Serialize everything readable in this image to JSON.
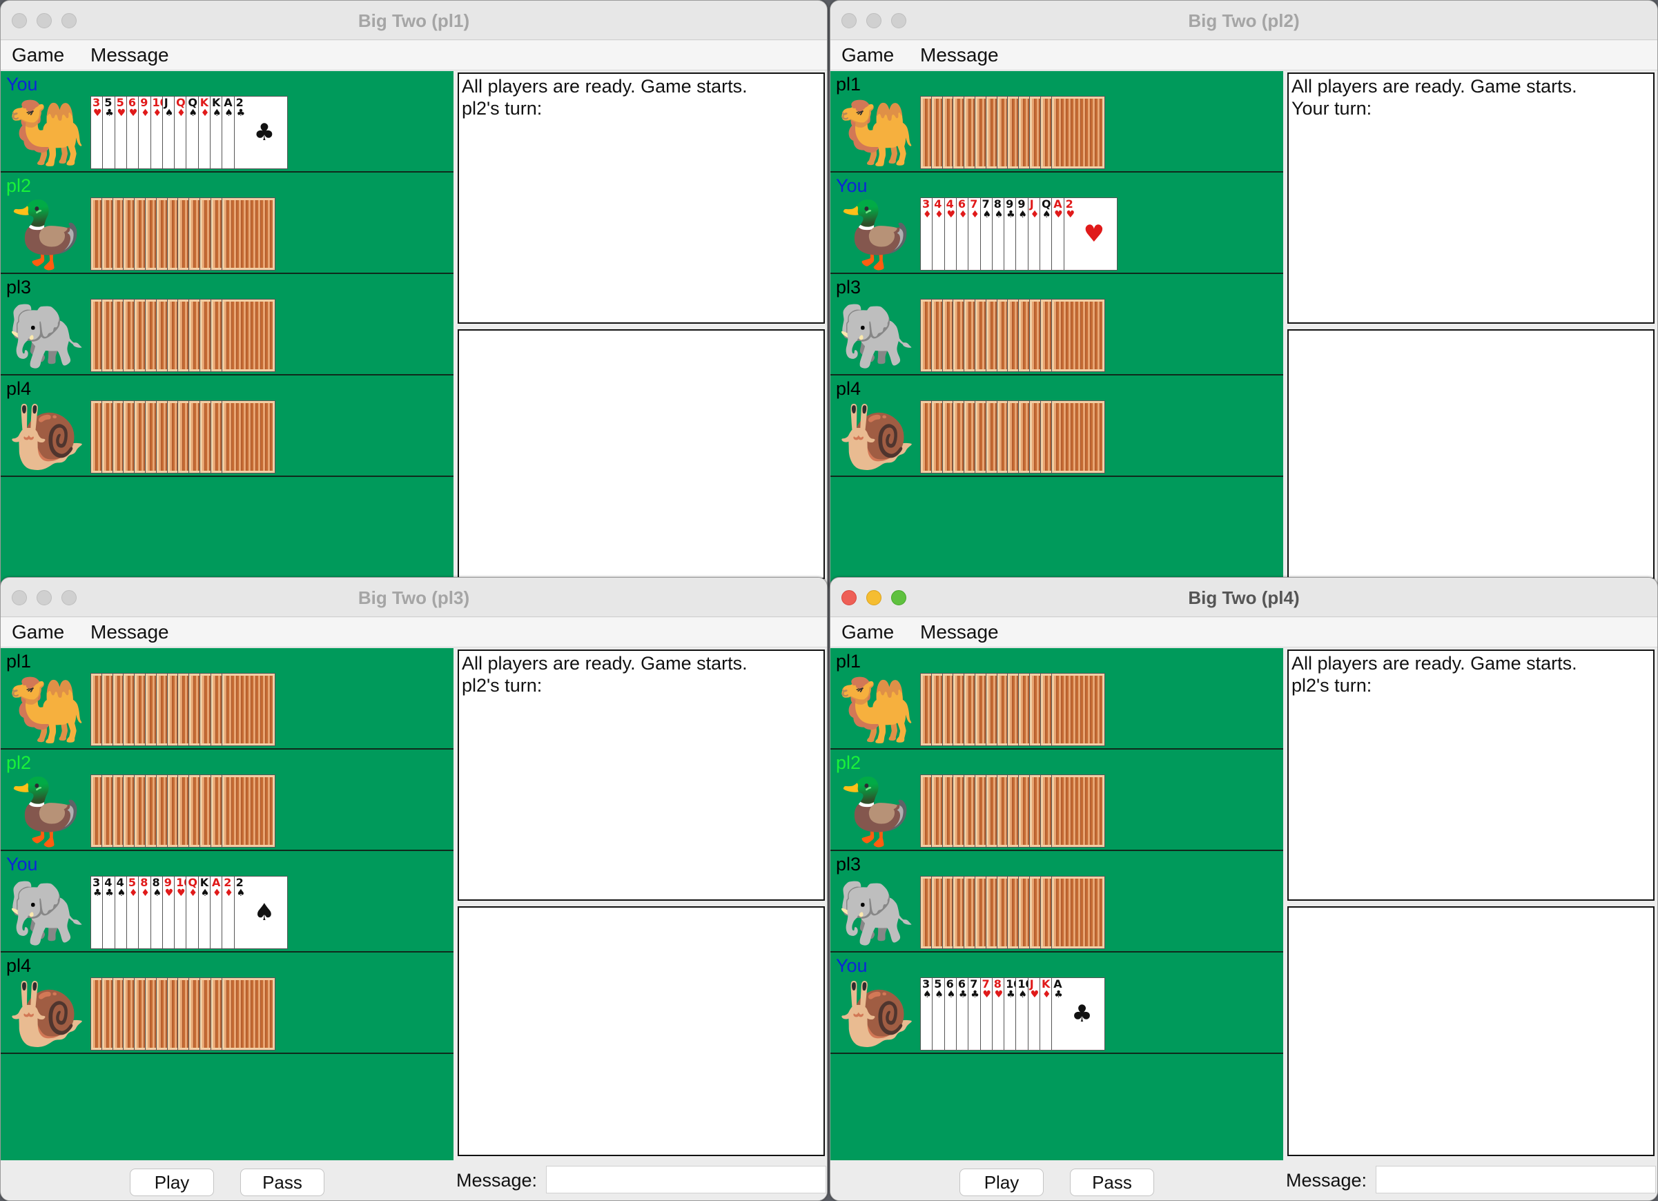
{
  "menu": {
    "game": "Game",
    "message": "Message"
  },
  "controls": {
    "play": "Play",
    "pass": "Pass",
    "message_label": "Message:",
    "message_value": ""
  },
  "windows": [
    {
      "title": "Big Two (pl1)",
      "messages": [
        "All players are ready. Game starts.",
        "pl2's turn:"
      ],
      "players": [
        {
          "name": "You",
          "avatar": "camel",
          "avatar_glyph": "🐫"
        },
        {
          "name": "pl2",
          "avatar": "duck",
          "avatar_glyph": "🦆"
        },
        {
          "name": "pl3",
          "avatar": "elephant",
          "avatar_glyph": "🐘"
        },
        {
          "name": "pl4",
          "avatar": "snail",
          "avatar_glyph": "🐌"
        }
      ],
      "hand": [
        {
          "rank": "3",
          "suit": "♥",
          "color": "red"
        },
        {
          "rank": "5",
          "suit": "♣",
          "color": "blk"
        },
        {
          "rank": "5",
          "suit": "♥",
          "color": "red"
        },
        {
          "rank": "6",
          "suit": "♥",
          "color": "red"
        },
        {
          "rank": "9",
          "suit": "♦",
          "color": "red"
        },
        {
          "rank": "10",
          "suit": "♦",
          "color": "red"
        },
        {
          "rank": "J",
          "suit": "♠",
          "color": "blk"
        },
        {
          "rank": "Q",
          "suit": "♦",
          "color": "red"
        },
        {
          "rank": "Q",
          "suit": "♠",
          "color": "blk"
        },
        {
          "rank": "K",
          "suit": "♦",
          "color": "red"
        },
        {
          "rank": "K",
          "suit": "♠",
          "color": "blk"
        },
        {
          "rank": "A",
          "suit": "♠",
          "color": "blk"
        },
        {
          "rank": "2",
          "suit": "♣",
          "color": "blk"
        }
      ]
    },
    {
      "title": "Big Two (pl2)",
      "messages": [
        "All players are ready. Game starts.",
        "Your turn:"
      ],
      "players": [
        {
          "name": "pl1",
          "avatar": "camel",
          "avatar_glyph": "🐫"
        },
        {
          "name": "You",
          "avatar": "duck",
          "avatar_glyph": "🦆"
        },
        {
          "name": "pl3",
          "avatar": "elephant",
          "avatar_glyph": "🐘"
        },
        {
          "name": "pl4",
          "avatar": "snail",
          "avatar_glyph": "🐌"
        }
      ],
      "hand": [
        {
          "rank": "3",
          "suit": "♦",
          "color": "red"
        },
        {
          "rank": "4",
          "suit": "♦",
          "color": "red"
        },
        {
          "rank": "4",
          "suit": "♥",
          "color": "red"
        },
        {
          "rank": "6",
          "suit": "♦",
          "color": "red"
        },
        {
          "rank": "7",
          "suit": "♦",
          "color": "red"
        },
        {
          "rank": "7",
          "suit": "♠",
          "color": "blk"
        },
        {
          "rank": "8",
          "suit": "♠",
          "color": "blk"
        },
        {
          "rank": "9",
          "suit": "♣",
          "color": "blk"
        },
        {
          "rank": "9",
          "suit": "♠",
          "color": "blk"
        },
        {
          "rank": "J",
          "suit": "♦",
          "color": "red"
        },
        {
          "rank": "Q",
          "suit": "♠",
          "color": "blk"
        },
        {
          "rank": "A",
          "suit": "♥",
          "color": "red"
        },
        {
          "rank": "2",
          "suit": "♥",
          "color": "red"
        }
      ]
    },
    {
      "title": "Big Two (pl3)",
      "messages": [
        "All players are ready. Game starts.",
        "pl2's turn:"
      ],
      "players": [
        {
          "name": "pl1",
          "avatar": "camel",
          "avatar_glyph": "🐫"
        },
        {
          "name": "pl2",
          "avatar": "duck",
          "avatar_glyph": "🦆"
        },
        {
          "name": "You",
          "avatar": "elephant",
          "avatar_glyph": "🐘"
        },
        {
          "name": "pl4",
          "avatar": "snail",
          "avatar_glyph": "🐌"
        }
      ],
      "hand": [
        {
          "rank": "3",
          "suit": "♣",
          "color": "blk"
        },
        {
          "rank": "4",
          "suit": "♣",
          "color": "blk"
        },
        {
          "rank": "4",
          "suit": "♠",
          "color": "blk"
        },
        {
          "rank": "5",
          "suit": "♦",
          "color": "red"
        },
        {
          "rank": "8",
          "suit": "♦",
          "color": "red"
        },
        {
          "rank": "8",
          "suit": "♠",
          "color": "blk"
        },
        {
          "rank": "9",
          "suit": "♥",
          "color": "red"
        },
        {
          "rank": "10",
          "suit": "♥",
          "color": "red"
        },
        {
          "rank": "Q",
          "suit": "♦",
          "color": "red"
        },
        {
          "rank": "K",
          "suit": "♠",
          "color": "blk"
        },
        {
          "rank": "A",
          "suit": "♦",
          "color": "red"
        },
        {
          "rank": "2",
          "suit": "♦",
          "color": "red"
        },
        {
          "rank": "2",
          "suit": "♠",
          "color": "blk"
        }
      ]
    },
    {
      "title": "Big Two (pl4)",
      "messages": [
        "All players are ready. Game starts.",
        "pl2's turn:"
      ],
      "players": [
        {
          "name": "pl1",
          "avatar": "camel",
          "avatar_glyph": "🐫"
        },
        {
          "name": "pl2",
          "avatar": "duck",
          "avatar_glyph": "🦆"
        },
        {
          "name": "pl3",
          "avatar": "elephant",
          "avatar_glyph": "🐘"
        },
        {
          "name": "You",
          "avatar": "snail",
          "avatar_glyph": "🐌"
        }
      ],
      "hand": [
        {
          "rank": "3",
          "suit": "♠",
          "color": "blk"
        },
        {
          "rank": "5",
          "suit": "♠",
          "color": "blk"
        },
        {
          "rank": "6",
          "suit": "♠",
          "color": "blk"
        },
        {
          "rank": "6",
          "suit": "♣",
          "color": "blk"
        },
        {
          "rank": "7",
          "suit": "♣",
          "color": "blk"
        },
        {
          "rank": "7",
          "suit": "♥",
          "color": "red"
        },
        {
          "rank": "8",
          "suit": "♥",
          "color": "red"
        },
        {
          "rank": "10",
          "suit": "♣",
          "color": "blk"
        },
        {
          "rank": "10",
          "suit": "♠",
          "color": "blk"
        },
        {
          "rank": "J",
          "suit": "♥",
          "color": "red"
        },
        {
          "rank": "K",
          "suit": "♦",
          "color": "red"
        },
        {
          "rank": "A",
          "suit": "♣",
          "color": "blk"
        }
      ]
    }
  ],
  "colors": {
    "table": "#009a5b",
    "you_label": "#0d24d8",
    "pl2_label": "#19f23a"
  }
}
